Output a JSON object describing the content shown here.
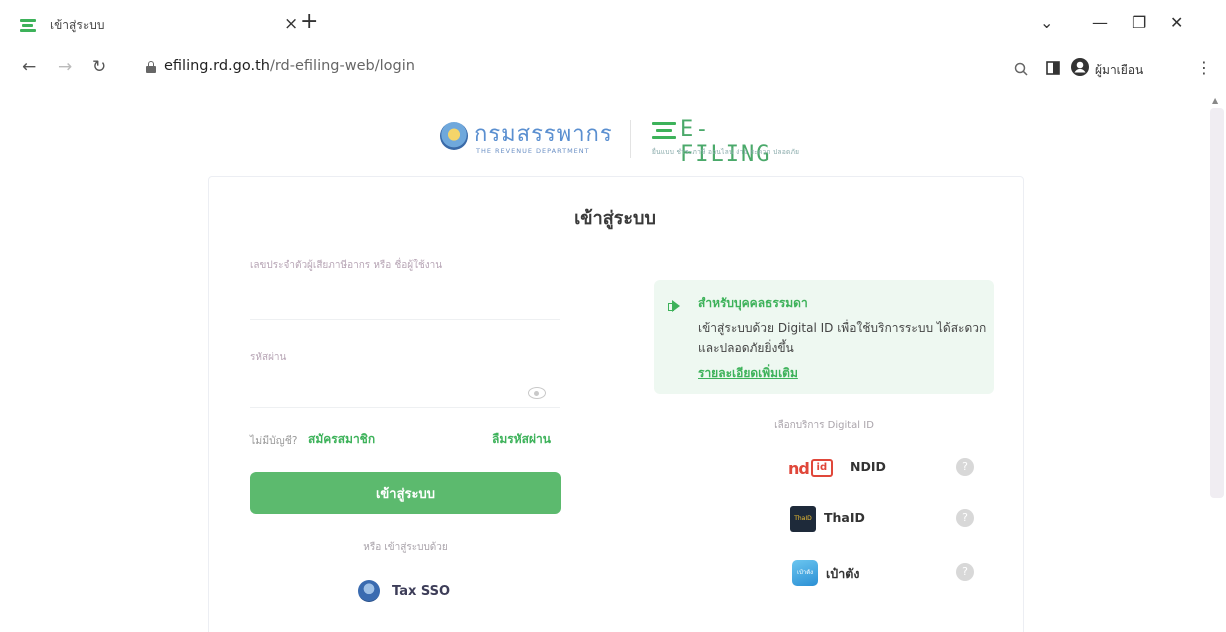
{
  "browser": {
    "tab_title": "เข้าสู่ระบบ",
    "tab_close": "×",
    "new_tab": "+",
    "url_domain": "efiling.rd.go.th",
    "url_path": "/rd-efiling-web/login",
    "profile_name": "ผู้มาเยือน",
    "win_controls": {
      "dropdown": "⌄",
      "minimize": "—",
      "restore": "❐",
      "close": "✕"
    },
    "nav": {
      "back": "←",
      "forward": "→",
      "reload": "↻"
    },
    "menu": "⋮"
  },
  "header": {
    "rd_name": "กรมสรรพากร",
    "rd_sub": "THE REVENUE DEPARTMENT",
    "efiling_name": "E-FILING",
    "efiling_sub": "ยื่นแบบ ชำระภาษี ออนไลน์ ง่าย สะดวก ปลอดภัย"
  },
  "login": {
    "title": "เข้าสู่ระบบ",
    "username_label": "เลขประจำตัวผู้เสียภาษีอากร หรือ ชื่อผู้ใช้งาน",
    "username_value": "",
    "password_label": "รหัสผ่าน",
    "password_value": "",
    "no_account": "ไม่มีบัญชี?",
    "register": "สมัครสมาชิก",
    "forgot": "ลืมรหัสผ่าน",
    "submit": "เข้าสู่ระบบ",
    "or_login_with": "หรือ เข้าสู่ระบบด้วย",
    "tax_sso": "Tax SSO"
  },
  "digital_id": {
    "info_title": "สำหรับบุคคลธรรมดา",
    "info_text": "เข้าสู่ระบบด้วย Digital ID เพื่อใช้บริการระบบ ได้สะดวกและปลอดภัยยิ่งขึ้น",
    "info_link": "รายละเอียดเพิ่มเติม",
    "choose_label": "เลือกบริการ Digital ID",
    "providers": [
      {
        "name": "NDID",
        "logo_text": "nd",
        "logo_badge": "id"
      },
      {
        "name": "ThaID",
        "logo_text": "ThaID"
      },
      {
        "name": "เป๋าตัง",
        "logo_text": "เป๋าตัง"
      }
    ],
    "help_glyph": "?"
  },
  "colors": {
    "brand_green": "#3db25a",
    "button_green": "#5cba6e",
    "rd_blue": "#5a8fd0",
    "info_bg": "#eef8f1"
  }
}
